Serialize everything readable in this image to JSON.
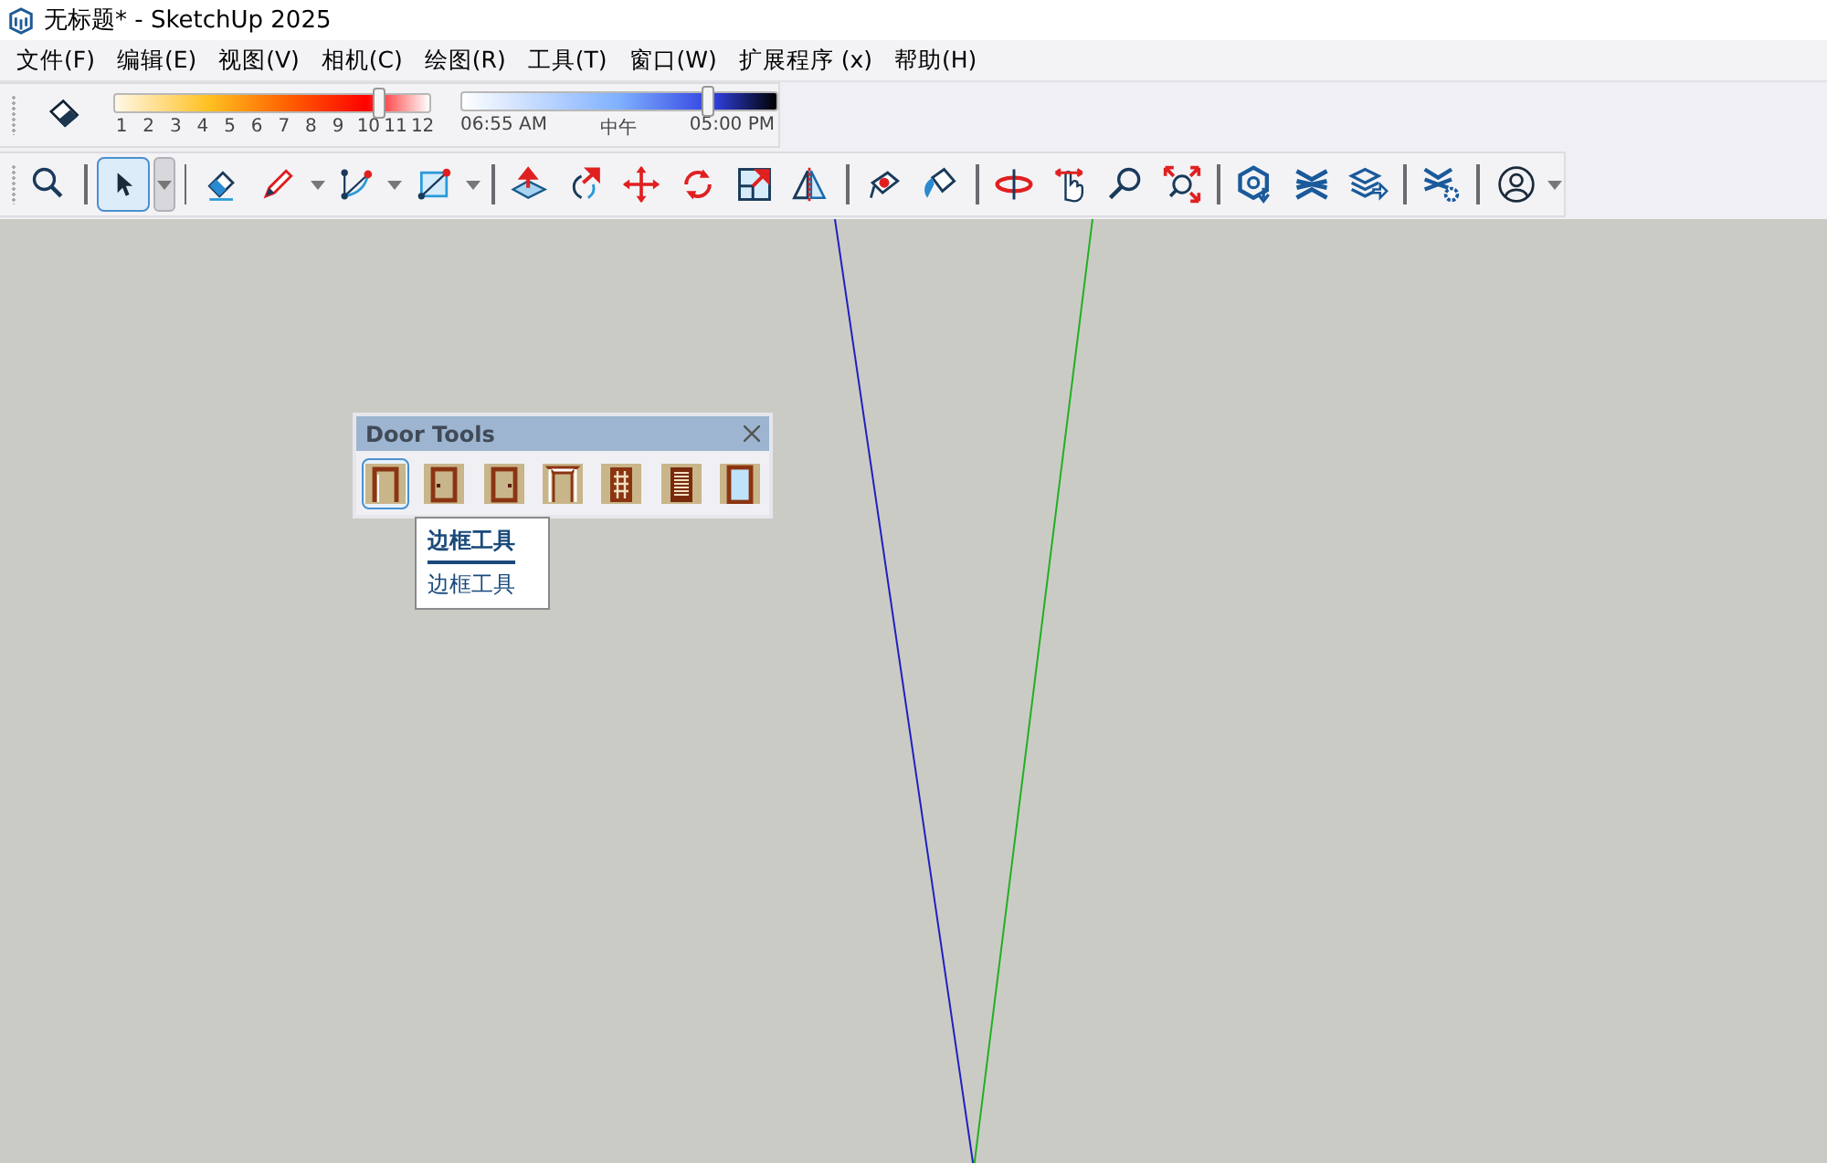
{
  "window": {
    "title": "无标题* - SketchUp 2025"
  },
  "menu": [
    "文件(F)",
    "编辑(E)",
    "视图(V)",
    "相机(C)",
    "绘图(R)",
    "工具(T)",
    "窗口(W)",
    "扩展程序 (x)",
    "帮助(H)"
  ],
  "shadow_bar": {
    "month_slider": {
      "level": 0.84,
      "ticks": [
        "1",
        "2",
        "3",
        "4",
        "5",
        "6",
        "7",
        "8",
        "9",
        "10",
        "11",
        "12"
      ]
    },
    "time_slider": {
      "level": 0.78,
      "ticks": [
        "06:55 AM",
        "中午",
        "05:00 PM"
      ]
    }
  },
  "toolbar": [
    {
      "kind": "tool",
      "selected": false
    },
    {
      "kind": "separator"
    },
    {
      "kind": "tool",
      "selected": true,
      "dropdown": true
    },
    {
      "kind": "separator"
    },
    {
      "kind": "tool",
      "selected": false
    },
    {
      "kind": "tool",
      "selected": false,
      "dropdown": true
    },
    {
      "kind": "tool",
      "selected": false,
      "dropdown": true
    },
    {
      "kind": "tool",
      "selected": false,
      "dropdown": true
    },
    {
      "kind": "separator"
    },
    {
      "kind": "tool",
      "selected": false
    },
    {
      "kind": "tool",
      "selected": false
    },
    {
      "kind": "tool",
      "selected": false
    },
    {
      "kind": "tool",
      "selected": false
    },
    {
      "kind": "tool",
      "selected": false
    },
    {
      "kind": "tool",
      "selected": false
    },
    {
      "kind": "separator"
    },
    {
      "kind": "tool",
      "selected": false
    },
    {
      "kind": "tool",
      "selected": false
    },
    {
      "kind": "separator"
    },
    {
      "kind": "tool",
      "selected": false
    },
    {
      "kind": "tool",
      "selected": false
    },
    {
      "kind": "tool",
      "selected": false
    },
    {
      "kind": "tool",
      "selected": false
    },
    {
      "kind": "separator"
    },
    {
      "kind": "tool",
      "selected": false
    },
    {
      "kind": "tool",
      "selected": false
    },
    {
      "kind": "tool",
      "selected": false
    },
    {
      "kind": "separator"
    },
    {
      "kind": "tool",
      "selected": false
    },
    {
      "kind": "separator"
    },
    {
      "kind": "tool",
      "selected": false,
      "dropdown": true
    }
  ],
  "door_tools": {
    "title": "Door Tools",
    "buttons": [
      {
        "selected": true
      },
      {
        "selected": false
      },
      {
        "selected": false
      },
      {
        "selected": false
      },
      {
        "selected": false
      },
      {
        "selected": false
      },
      {
        "selected": false
      }
    ],
    "tooltip": {
      "title": "边框工具",
      "description": "边框工具"
    }
  }
}
